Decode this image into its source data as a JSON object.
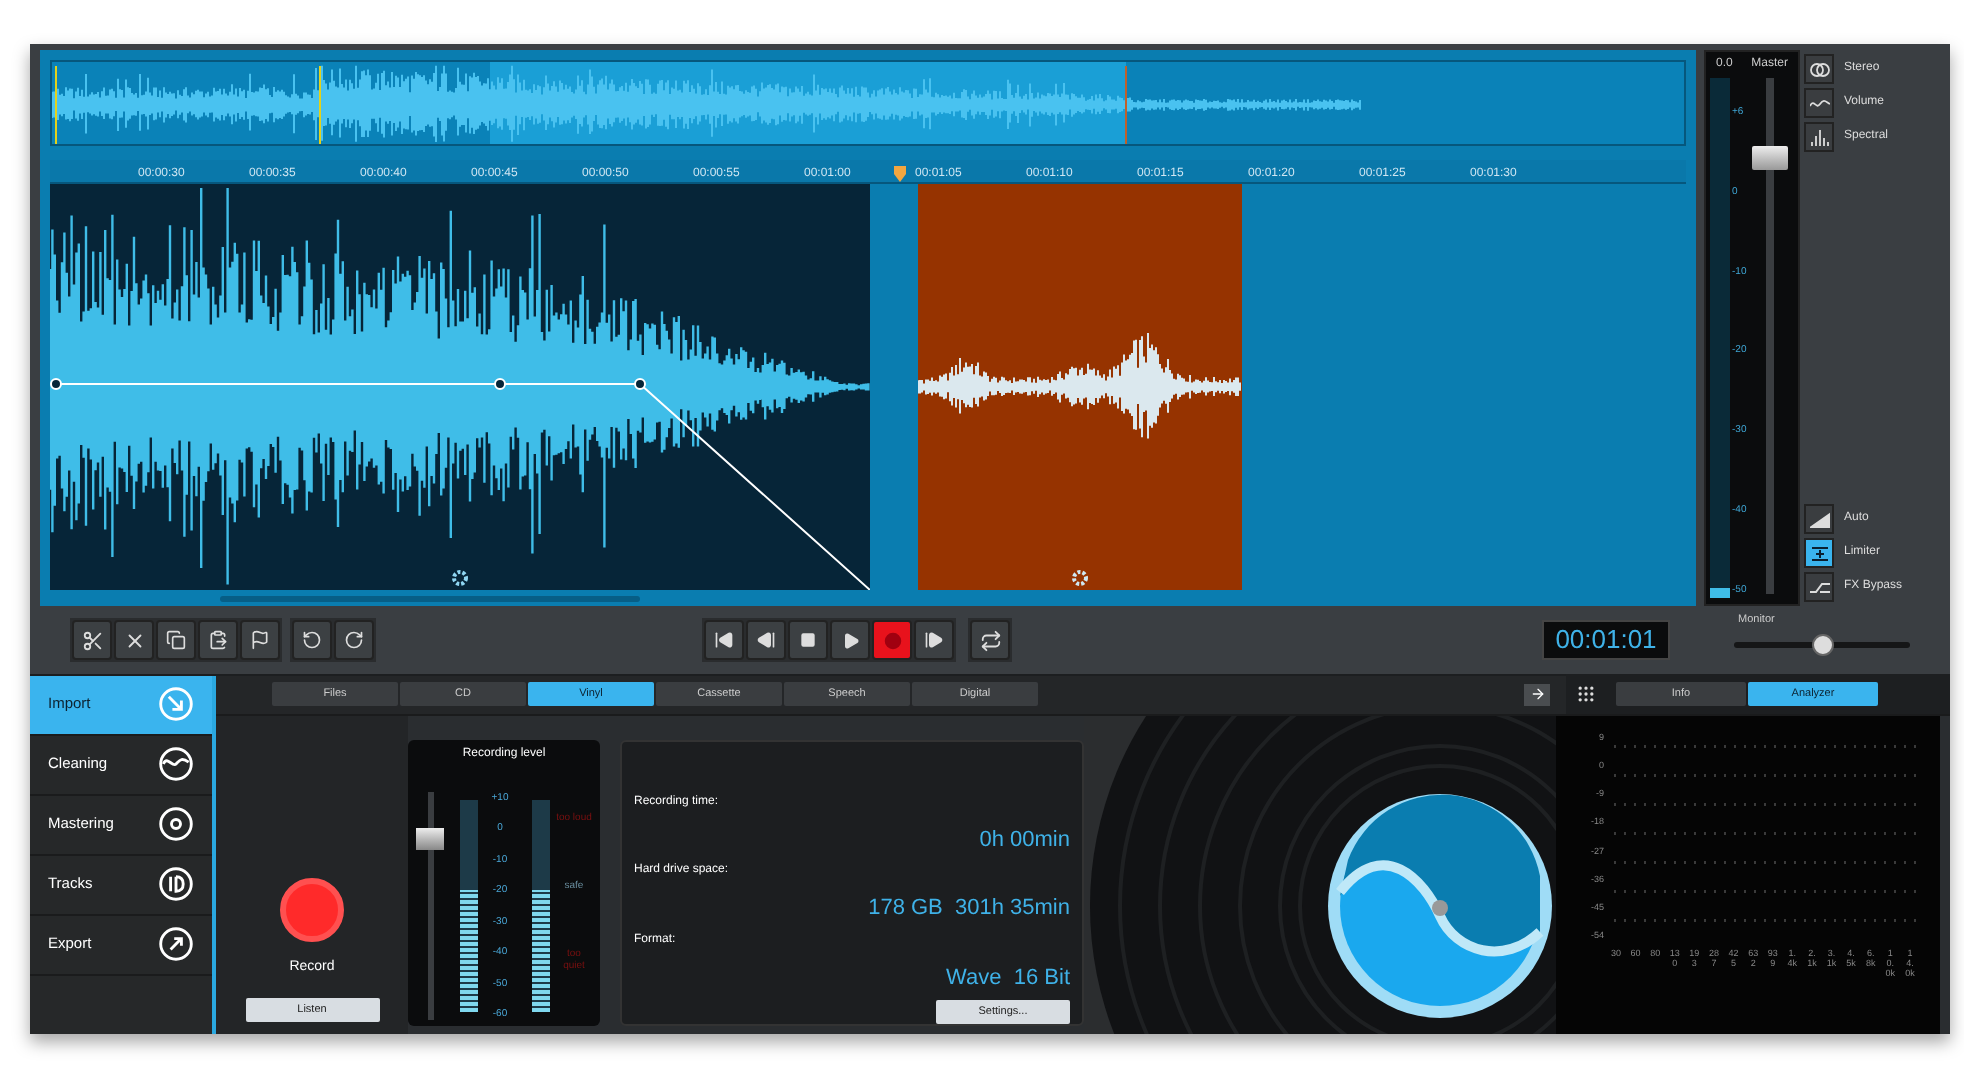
{
  "ruler": [
    "00:00:30",
    "00:00:35",
    "00:00:40",
    "00:00:45",
    "00:00:50",
    "00:00:55",
    "00:01:00",
    "00:01:05",
    "00:01:10",
    "00:01:15",
    "00:01:20",
    "00:01:25",
    "00:01:30"
  ],
  "master": {
    "readout": "0.0",
    "label": "Master",
    "fader": {
      "level": 0.86
    },
    "meter": {
      "level": 0.02
    },
    "scale": [
      "+6",
      "0",
      "-10",
      "-20",
      "-30",
      "-40",
      "-50"
    ]
  },
  "view_buttons": [
    {
      "label": "Stereo",
      "on": false
    },
    {
      "label": "Volume",
      "on": false
    },
    {
      "label": "Spectral",
      "on": false
    }
  ],
  "fx_buttons": [
    {
      "label": "Auto",
      "on": false
    },
    {
      "label": "Limiter",
      "on": true
    },
    {
      "label": "FX Bypass",
      "on": false
    }
  ],
  "monitor": {
    "label": "Monitor",
    "level": 0.5
  },
  "time_display": "00:01:01",
  "sidebar": [
    {
      "label": "Import",
      "selected": true
    },
    {
      "label": "Cleaning",
      "selected": false
    },
    {
      "label": "Mastering",
      "selected": false
    },
    {
      "label": "Tracks",
      "selected": false
    },
    {
      "label": "Export",
      "selected": false
    }
  ],
  "source_tabs": [
    {
      "label": "Files",
      "selected": false
    },
    {
      "label": "CD",
      "selected": false
    },
    {
      "label": "Vinyl",
      "selected": true
    },
    {
      "label": "Cassette",
      "selected": false
    },
    {
      "label": "Speech",
      "selected": false
    },
    {
      "label": "Digital",
      "selected": false
    }
  ],
  "record": {
    "button": "Record",
    "listen": "Listen"
  },
  "recording_level": {
    "title": "Recording level",
    "fader": {
      "level": 0.82
    },
    "meters": [
      {
        "level": 0.57
      },
      {
        "level": 0.57
      }
    ],
    "scale": [
      "+10",
      "0",
      "-10",
      "-20",
      "-30",
      "-40",
      "-50",
      "-60"
    ],
    "zones": [
      "too loud",
      "safe",
      "too quiet"
    ]
  },
  "info": {
    "fields": [
      {
        "label": "Recording time:",
        "value": "0h 00min"
      },
      {
        "label": "Hard drive space:",
        "value": "178 GB  301h 35min"
      },
      {
        "label": "Format:",
        "value": "Wave  16 Bit"
      }
    ],
    "settings": "Settings..."
  },
  "panel_tabs": [
    {
      "label": "Info",
      "selected": false
    },
    {
      "label": "Analyzer",
      "selected": true
    }
  ],
  "analyzer": {
    "y_labels": [
      "9",
      "0",
      "-9",
      "-18",
      "-27",
      "-36",
      "-45",
      "-54"
    ],
    "x_labels": [
      "30",
      "60",
      "80",
      "130",
      "193",
      "287",
      "425",
      "632",
      "939",
      "1.4k",
      "2.1k",
      "3.1k",
      "4.5k",
      "6.8k",
      "10.0k",
      "14.0k"
    ]
  }
}
